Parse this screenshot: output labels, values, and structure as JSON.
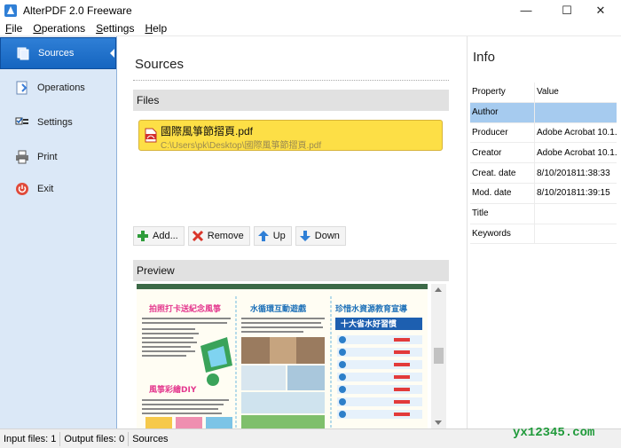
{
  "window": {
    "title": "AlterPDF 2.0 Freeware",
    "min": "—",
    "max": "☐",
    "close": "✕"
  },
  "menu": [
    {
      "underline": "F",
      "rest": "ile"
    },
    {
      "underline": "O",
      "rest": "perations"
    },
    {
      "underline": "S",
      "rest": "ettings"
    },
    {
      "underline": "H",
      "rest": "elp"
    }
  ],
  "sidebar": {
    "items": [
      {
        "label": "Sources"
      },
      {
        "label": "Operations"
      },
      {
        "label": "Settings"
      },
      {
        "label": "Print"
      },
      {
        "label": "Exit"
      }
    ]
  },
  "main": {
    "title": "Sources",
    "files_header": "Files",
    "file": {
      "name": "國際風箏節摺頁.pdf",
      "path": "C:\\Users\\pk\\Desktop\\國際風箏節摺頁.pdf"
    },
    "toolbar": {
      "add": "Add...",
      "remove": "Remove",
      "up": "Up",
      "down": "Down"
    },
    "preview_header": "Preview",
    "preview_doc": {
      "col1_title": "拍照打卡送紀念風箏",
      "col2_title": "水循環互動遊戲",
      "col3_title": "珍惜水資源教育宣導",
      "col3_banner": "十大省水好習慣",
      "col1_sub": "風箏彩繪DIY"
    }
  },
  "info": {
    "title": "Info",
    "header": {
      "property": "Property",
      "value": "Value"
    },
    "rows": [
      {
        "property": "Author",
        "value": ""
      },
      {
        "property": "Producer",
        "value": "Adobe Acrobat 10.1."
      },
      {
        "property": "Creator",
        "value": "Adobe Acrobat 10.1."
      },
      {
        "property": "Creat. date",
        "value": "8/10/201811:38:33"
      },
      {
        "property": "Mod. date",
        "value": "8/10/201811:39:15"
      },
      {
        "property": "Title",
        "value": ""
      },
      {
        "property": "Keywords",
        "value": ""
      }
    ]
  },
  "status": {
    "input_files": "Input files: 1",
    "output_files": "Output files: 0",
    "mode": "Sources"
  },
  "watermark": "yx12345.com",
  "colors": {
    "accent": "#1565c0",
    "sidebar_bg": "#dbe8f7",
    "file_card": "#fddf46",
    "selected_row": "#a6cbef"
  }
}
